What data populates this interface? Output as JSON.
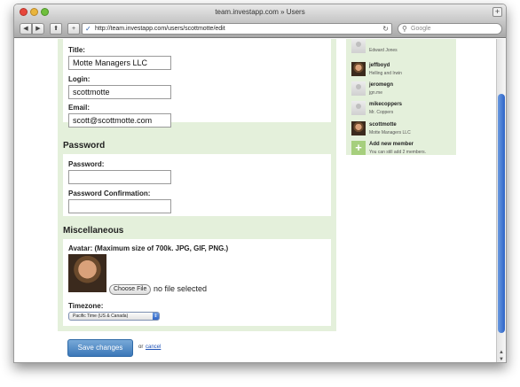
{
  "window": {
    "title": "team.investapp.com » Users",
    "url": "http://team.investapp.com/users/scottmotte/edit",
    "search_placeholder": "Google"
  },
  "form": {
    "title_label": "Title:",
    "title_value": "Motte Managers LLC",
    "login_label": "Login:",
    "login_value": "scottmotte",
    "email_label": "Email:",
    "email_value": "scott@scottmotte.com",
    "password_section": "Password",
    "password_label": "Password:",
    "password_confirmation_label": "Password Confirmation:",
    "misc_section": "Miscellaneous",
    "avatar_label": "Avatar: (Maximum size of 700k. JPG, GIF, PNG.)",
    "choose_file_label": "Choose File",
    "no_file_text": "no file selected",
    "timezone_label": "Timezone:",
    "timezone_value": "Pacific Time (US & Canada)",
    "save_label": "Save changes",
    "or_text": "or",
    "cancel_label": "cancel"
  },
  "members": [
    {
      "name": "",
      "company": "Edward Jones",
      "avatar": "placeholder"
    },
    {
      "name": "jeffboyd",
      "company": "Helling and Irwin",
      "avatar": "photo"
    },
    {
      "name": "jeromegn",
      "company": "jgn.me",
      "avatar": "placeholder"
    },
    {
      "name": "mikecoppers",
      "company": "Mr. Coppers",
      "avatar": "placeholder"
    },
    {
      "name": "scottmotte",
      "company": "Motte Managers LLC",
      "avatar": "photo"
    }
  ],
  "add_member": {
    "label": "Add new member",
    "note": "You can still add 2 members."
  },
  "colors": {
    "panel_green": "#e4f0db",
    "save_blue": "#3b77b8",
    "scroll_blue": "#2e64c7"
  }
}
